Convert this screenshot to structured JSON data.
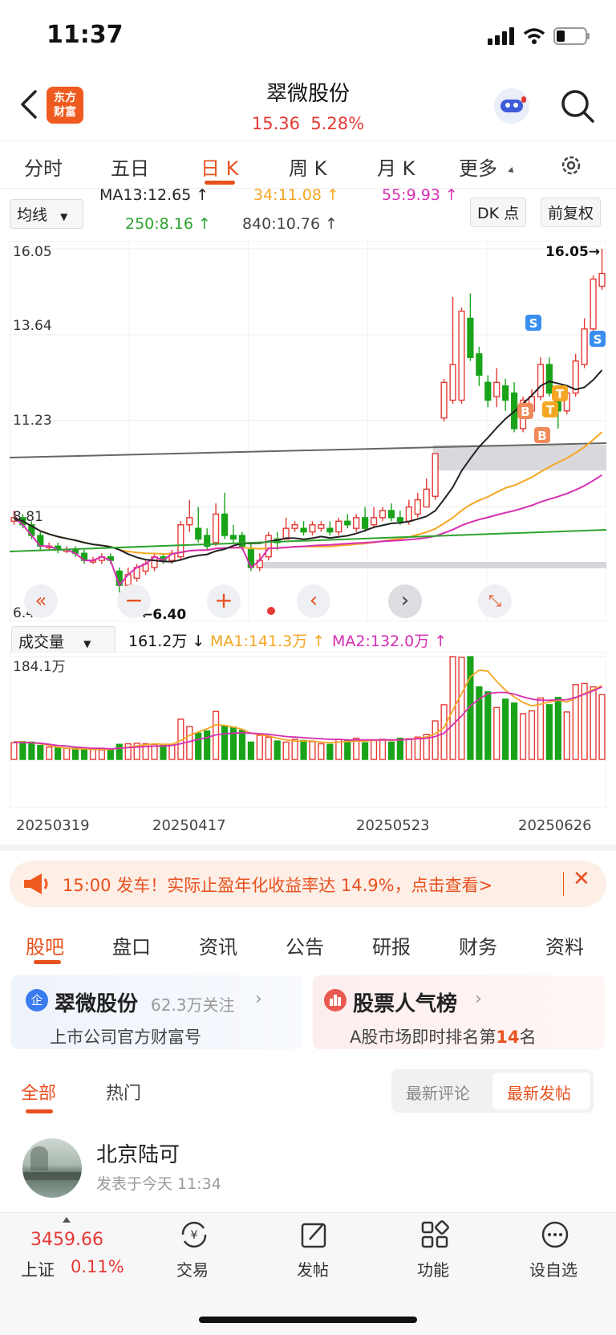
{
  "status_bar": {
    "time": "11:37"
  },
  "header": {
    "logo_text": "东方\n财富",
    "title": "翠微股份",
    "price": "15.36",
    "change_pct": "5.28%",
    "icons": [
      "back-arrow-icon",
      "robot-avatar-icon",
      "search-icon"
    ]
  },
  "period_tabs": [
    {
      "label": "分时"
    },
    {
      "label": "五日"
    },
    {
      "label": "日 K"
    },
    {
      "label": "周 K"
    },
    {
      "label": "月 K"
    },
    {
      "label": "更多"
    }
  ],
  "active_tab": "日 K",
  "ma_panel": {
    "selector": "均线",
    "ma13": "MA13:12.65 ↑",
    "ma34": "34:11.08 ↑",
    "ma55": "55:9.93 ↑",
    "ma250": "250:8.16 ↑",
    "ma840": "840:10.76 ↑",
    "dk_button": "DK 点",
    "fq_button": "前复权"
  },
  "price_axis": [
    "16.05",
    "13.64",
    "11.23",
    "8.81",
    "6.40"
  ],
  "price_markers": {
    "high": "16.05→",
    "low": "←6.40"
  },
  "trade_markers": [
    "S",
    "S",
    "B",
    "B",
    "T",
    "T"
  ],
  "volume_panel": {
    "selector": "成交量",
    "vol": "161.2万 ↓",
    "ma1": "MA1:141.3万 ↑",
    "ma2": "MA2:132.0万 ↑",
    "axis_max": "184.1万"
  },
  "dates": [
    "20250319",
    "20250417",
    "20250523",
    "20250626"
  ],
  "colors": {
    "up": "#e53935",
    "down": "#19a319",
    "accent": "#e8511e",
    "ma13": "#222222",
    "ma34": "#f5a623",
    "ma55": "#d62fb1",
    "ma250": "#2ea32e"
  },
  "chart_data": {
    "type": "candlestick",
    "y_range": [
      6.4,
      16.05
    ],
    "candles": [
      {
        "o": 8.4,
        "c": 8.5,
        "h": 8.7,
        "l": 8.3
      },
      {
        "o": 8.5,
        "c": 8.3,
        "h": 8.6,
        "l": 8.2
      },
      {
        "o": 8.3,
        "c": 8.0,
        "h": 8.4,
        "l": 7.9
      },
      {
        "o": 8.0,
        "c": 7.7,
        "h": 8.1,
        "l": 7.6
      },
      {
        "o": 7.7,
        "c": 7.7,
        "h": 7.8,
        "l": 7.6
      },
      {
        "o": 7.7,
        "c": 7.6,
        "h": 7.8,
        "l": 7.5
      },
      {
        "o": 7.6,
        "c": 7.6,
        "h": 7.7,
        "l": 7.5
      },
      {
        "o": 7.6,
        "c": 7.5,
        "h": 7.7,
        "l": 7.4
      },
      {
        "o": 7.5,
        "c": 7.3,
        "h": 7.6,
        "l": 7.2
      },
      {
        "o": 7.3,
        "c": 7.3,
        "h": 7.4,
        "l": 7.2
      },
      {
        "o": 7.3,
        "c": 7.4,
        "h": 7.5,
        "l": 7.2
      },
      {
        "o": 7.4,
        "c": 7.3,
        "h": 7.5,
        "l": 7.2
      },
      {
        "o": 7.0,
        "c": 6.6,
        "h": 7.1,
        "l": 6.4
      },
      {
        "o": 6.6,
        "c": 6.9,
        "h": 7.1,
        "l": 6.4
      },
      {
        "o": 6.8,
        "c": 7.1,
        "h": 7.2,
        "l": 6.7
      },
      {
        "o": 7.0,
        "c": 7.2,
        "h": 7.3,
        "l": 6.9
      },
      {
        "o": 7.1,
        "c": 7.4,
        "h": 7.5,
        "l": 7.0
      },
      {
        "o": 7.4,
        "c": 7.3,
        "h": 7.5,
        "l": 7.2
      },
      {
        "o": 7.3,
        "c": 7.5,
        "h": 7.6,
        "l": 7.2
      },
      {
        "o": 7.4,
        "c": 8.3,
        "h": 8.4,
        "l": 7.3
      },
      {
        "o": 8.3,
        "c": 8.5,
        "h": 9.0,
        "l": 8.1
      },
      {
        "o": 8.2,
        "c": 7.9,
        "h": 8.8,
        "l": 7.8
      },
      {
        "o": 8.0,
        "c": 7.7,
        "h": 8.2,
        "l": 7.6
      },
      {
        "o": 7.8,
        "c": 8.6,
        "h": 8.9,
        "l": 7.7
      },
      {
        "o": 8.6,
        "c": 8.0,
        "h": 9.2,
        "l": 7.9
      },
      {
        "o": 8.0,
        "c": 7.9,
        "h": 8.3,
        "l": 7.8
      },
      {
        "o": 8.0,
        "c": 7.7,
        "h": 8.1,
        "l": 7.6
      },
      {
        "o": 7.6,
        "c": 7.1,
        "h": 7.8,
        "l": 7.0
      },
      {
        "o": 7.1,
        "c": 7.3,
        "h": 7.5,
        "l": 7.0
      },
      {
        "o": 7.4,
        "c": 8.0,
        "h": 8.1,
        "l": 7.3
      },
      {
        "o": 7.9,
        "c": 7.8,
        "h": 8.1,
        "l": 7.6
      },
      {
        "o": 7.9,
        "c": 8.2,
        "h": 8.5,
        "l": 7.9
      },
      {
        "o": 8.2,
        "c": 8.3,
        "h": 8.4,
        "l": 8.1
      },
      {
        "o": 8.2,
        "c": 8.1,
        "h": 8.4,
        "l": 8.0
      },
      {
        "o": 8.1,
        "c": 8.3,
        "h": 8.4,
        "l": 8.0
      },
      {
        "o": 8.2,
        "c": 8.3,
        "h": 8.4,
        "l": 8.1
      },
      {
        "o": 8.2,
        "c": 8.1,
        "h": 8.4,
        "l": 8.0
      },
      {
        "o": 8.1,
        "c": 8.4,
        "h": 8.5,
        "l": 8.0
      },
      {
        "o": 8.4,
        "c": 8.3,
        "h": 8.6,
        "l": 8.2
      },
      {
        "o": 8.2,
        "c": 8.5,
        "h": 8.6,
        "l": 8.1
      },
      {
        "o": 8.5,
        "c": 8.2,
        "h": 8.8,
        "l": 8.1
      },
      {
        "o": 8.3,
        "c": 8.5,
        "h": 8.8,
        "l": 8.2
      },
      {
        "o": 8.5,
        "c": 8.7,
        "h": 8.8,
        "l": 8.4
      },
      {
        "o": 8.7,
        "c": 8.5,
        "h": 8.9,
        "l": 8.4
      },
      {
        "o": 8.5,
        "c": 8.4,
        "h": 8.7,
        "l": 8.3
      },
      {
        "o": 8.4,
        "c": 8.8,
        "h": 9.0,
        "l": 8.3
      },
      {
        "o": 8.6,
        "c": 9.0,
        "h": 9.2,
        "l": 8.5
      },
      {
        "o": 8.8,
        "c": 9.3,
        "h": 9.6,
        "l": 8.8
      },
      {
        "o": 9.1,
        "c": 10.3,
        "h": 10.3,
        "l": 9.0
      },
      {
        "o": 11.3,
        "c": 12.3,
        "h": 12.4,
        "l": 11.2
      },
      {
        "o": 11.8,
        "c": 12.8,
        "h": 14.7,
        "l": 11.7
      },
      {
        "o": 11.8,
        "c": 14.3,
        "h": 14.4,
        "l": 11.7
      },
      {
        "o": 14.1,
        "c": 13.0,
        "h": 14.8,
        "l": 12.9
      },
      {
        "o": 13.1,
        "c": 12.5,
        "h": 13.3,
        "l": 12.2
      },
      {
        "o": 12.3,
        "c": 11.8,
        "h": 12.5,
        "l": 11.6
      },
      {
        "o": 11.9,
        "c": 12.3,
        "h": 12.7,
        "l": 11.6
      },
      {
        "o": 12.2,
        "c": 11.8,
        "h": 12.4,
        "l": 11.5
      },
      {
        "o": 12.0,
        "c": 11.0,
        "h": 12.3,
        "l": 10.9
      },
      {
        "o": 11.0,
        "c": 11.8,
        "h": 11.9,
        "l": 10.9
      },
      {
        "o": 11.5,
        "c": 11.9,
        "h": 12.1,
        "l": 11.3
      },
      {
        "o": 11.9,
        "c": 12.8,
        "h": 13.0,
        "l": 11.8
      },
      {
        "o": 12.8,
        "c": 12.0,
        "h": 13.0,
        "l": 11.9
      },
      {
        "o": 12.0,
        "c": 11.5,
        "h": 12.2,
        "l": 11.0
      },
      {
        "o": 11.5,
        "c": 12.0,
        "h": 12.2,
        "l": 11.4
      },
      {
        "o": 12.0,
        "c": 12.9,
        "h": 13.1,
        "l": 11.9
      },
      {
        "o": 12.8,
        "c": 13.8,
        "h": 14.1,
        "l": 12.7
      },
      {
        "o": 13.8,
        "c": 15.2,
        "h": 15.3,
        "l": 13.7
      },
      {
        "o": 15.0,
        "c": 15.36,
        "h": 16.05,
        "l": 14.9
      }
    ],
    "volumes": [
      30,
      32,
      31,
      25,
      22,
      21,
      20,
      20,
      19,
      18,
      17,
      18,
      27,
      28,
      29,
      28,
      27,
      26,
      26,
      72,
      59,
      47,
      51,
      86,
      60,
      58,
      52,
      31,
      43,
      40,
      33,
      31,
      36,
      34,
      32,
      28,
      27,
      36,
      35,
      38,
      30,
      34,
      36,
      31,
      38,
      37,
      40,
      45,
      69,
      98,
      184.1,
      183,
      184,
      130,
      121,
      93,
      108,
      101,
      82,
      87,
      110,
      98,
      111,
      85,
      134,
      136,
      130,
      116
    ],
    "ma1": [
      32,
      31,
      30,
      28,
      25,
      22,
      20,
      19,
      19,
      18,
      18,
      18,
      20,
      22,
      24,
      26,
      28,
      27,
      27,
      34,
      43,
      49,
      55,
      62,
      61,
      58,
      54,
      47,
      44,
      42,
      38,
      35,
      33,
      33,
      33,
      31,
      30,
      31,
      32,
      33,
      33,
      34,
      35,
      34,
      35,
      36,
      38,
      40,
      46,
      57,
      88,
      118,
      148,
      160,
      158,
      140,
      124,
      112,
      102,
      96,
      99,
      103,
      106,
      103,
      110,
      118,
      125,
      132
    ],
    "ma2": [
      31,
      30,
      30,
      29,
      27,
      25,
      24,
      22,
      21,
      20,
      20,
      19,
      20,
      21,
      22,
      23,
      24,
      24,
      25,
      28,
      32,
      36,
      39,
      44,
      46,
      47,
      48,
      47,
      46,
      45,
      43,
      41,
      40,
      39,
      38,
      37,
      36,
      36,
      35,
      35,
      35,
      35,
      35,
      35,
      35,
      36,
      37,
      38,
      41,
      47,
      62,
      78,
      96,
      108,
      118,
      120,
      120,
      117,
      112,
      108,
      106,
      106,
      107,
      107,
      111,
      117,
      123,
      130
    ]
  },
  "ad_banner": {
    "text": "15:00 发车！实际止盈年化收益率达 14.9%，点击查看>"
  },
  "info_tabs": [
    {
      "label": "股吧"
    },
    {
      "label": "盘口"
    },
    {
      "label": "资讯"
    },
    {
      "label": "公告"
    },
    {
      "label": "研报"
    },
    {
      "label": "财务"
    },
    {
      "label": "资料"
    }
  ],
  "cards": {
    "left_title": "翠微股份",
    "left_follow": "62.3万关注",
    "left_sub": "上市公司官方财富号",
    "right_title": "股票人气榜",
    "right_sub_pre": "A股市场即时排名第",
    "right_rank": "14",
    "right_sub_post": "名"
  },
  "feed_tabs": {
    "all": "全部",
    "hot": "热门",
    "latest_comment": "最新评论",
    "latest_post": "最新发帖"
  },
  "post": {
    "author": "北京陆可",
    "time": "发表于今天 11:34"
  },
  "bottom_bar": {
    "index_value": "3459.66",
    "index_name": "上证",
    "index_change": "0.11%",
    "items": [
      {
        "label": "交易"
      },
      {
        "label": "发帖"
      },
      {
        "label": "功能"
      },
      {
        "label": "设自选"
      }
    ]
  }
}
